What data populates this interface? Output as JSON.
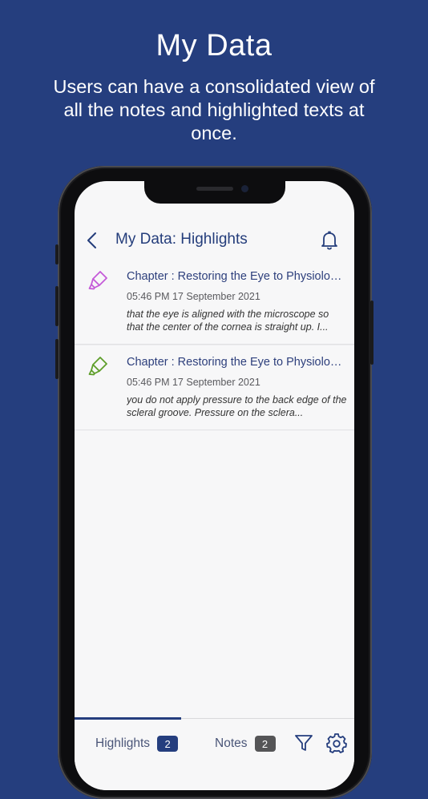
{
  "promo": {
    "title": "My Data",
    "subtitle": "Users can have a consolidated view of all the notes and highlighted texts at once."
  },
  "header": {
    "back_icon": "chevron-left-icon",
    "title": "My Data: Highlights",
    "bell_icon": "bell-icon"
  },
  "highlights": [
    {
      "icon": "highlighter-icon",
      "icon_color": "#c45ad8",
      "title": "Chapter : Restoring the Eye to Physiologi...",
      "timestamp": "05:46 PM 17 September 2021",
      "text": "that the eye is aligned with the microscope so that the center of the cornea is straight up. I..."
    },
    {
      "icon": "highlighter-icon",
      "icon_color": "#5e9e2a",
      "title": "Chapter : Restoring the Eye to Physiologi...",
      "timestamp": "05:46 PM 17 September 2021",
      "text": "you do not apply pressure to the back edge of the scleral groove. Pressure on the sclera..."
    }
  ],
  "tabs": {
    "highlights_label": "Highlights",
    "highlights_count": "2",
    "notes_label": "Notes",
    "notes_count": "2",
    "filter_icon": "filter-icon",
    "settings_icon": "gear-icon"
  },
  "colors": {
    "background": "#253e7e",
    "accent": "#253e7e",
    "notes_badge": "#555557"
  }
}
